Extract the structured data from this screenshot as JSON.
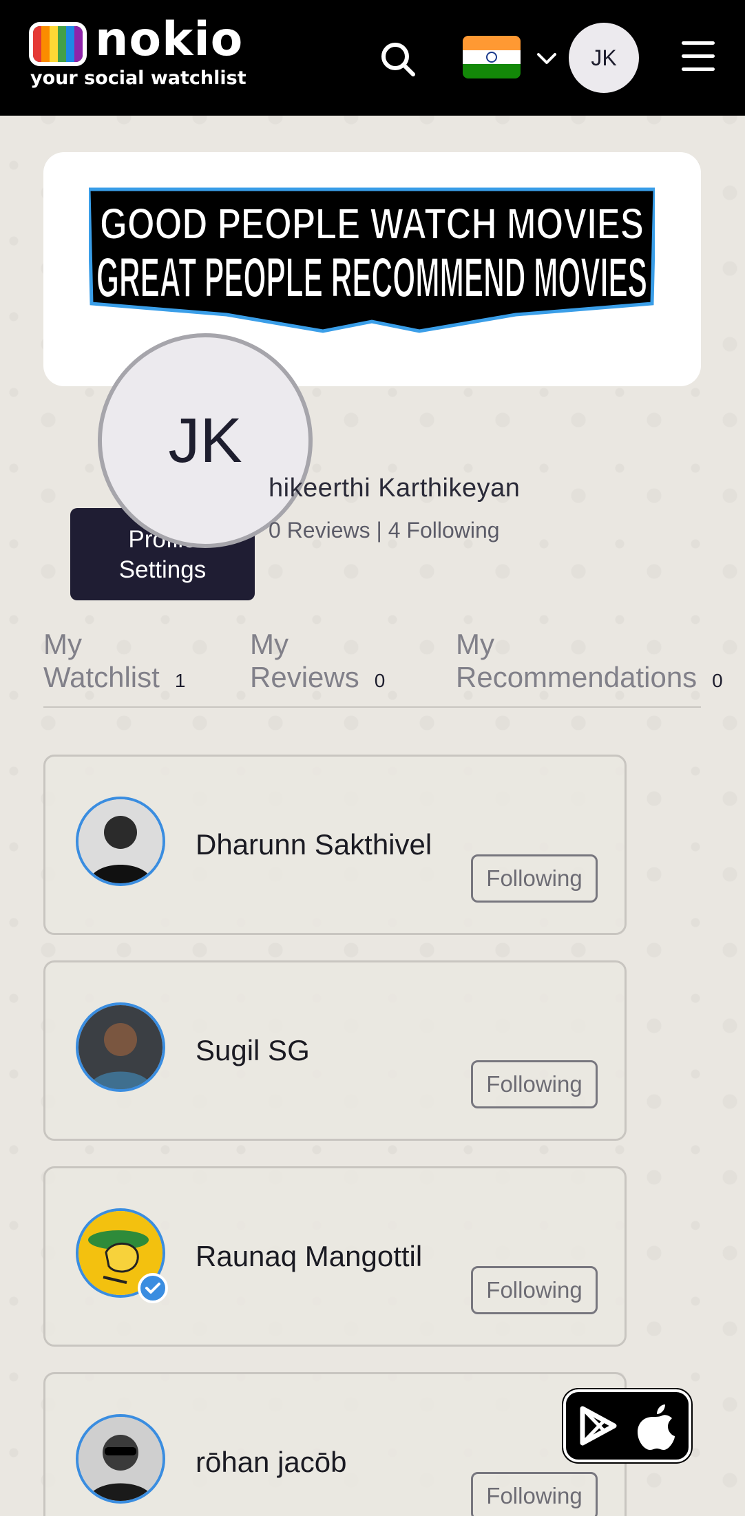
{
  "header": {
    "logo_name": "nokio",
    "logo_tagline": "your social watchlist",
    "logo_stripes": [
      "#e53935",
      "#fb8c00",
      "#fdd835",
      "#43a047",
      "#1e88e5",
      "#8e24aa"
    ],
    "search_icon": "search-icon",
    "country_flag": "india-flag-icon",
    "flag_colors": [
      "#ff9933",
      "#ffffff",
      "#138808"
    ],
    "menu_icon": "hamburger-menu-icon",
    "user_initials": "JK"
  },
  "banner": {
    "line1": "GOOD PEOPLE WATCH MOVIES",
    "line2": "GREAT PEOPLE RECOMMEND MOVIES"
  },
  "profile": {
    "initials": "JK",
    "name_visible": "hikeerthi Karthikeyan",
    "stats": "0 Reviews | 4 Following",
    "settings_line1": "Profile",
    "settings_line2": "Settings"
  },
  "tabs": [
    {
      "line1": "My",
      "line2": "Watchlist",
      "count": "1"
    },
    {
      "line1": "My",
      "line2": "Reviews",
      "count": "0"
    },
    {
      "line1": "My",
      "line2": "Recommendations",
      "count": "0"
    }
  ],
  "following": [
    {
      "name": "Dharunn Sakthivel",
      "button": "Following",
      "avatar": "user-photo-avatar"
    },
    {
      "name": "Sugil SG",
      "button": "Following",
      "avatar": "user-photo-avatar"
    },
    {
      "name": "Raunaq Mangottil",
      "button": "Following",
      "avatar": "cartoon-avatar",
      "verified": true
    },
    {
      "name": "rōhan jacōb",
      "button": "Following",
      "avatar": "user-photo-avatar"
    }
  ],
  "store_widget": {
    "icons": [
      "google-play-icon",
      "apple-icon"
    ]
  },
  "colors": {
    "accent_blue": "#3a8de0",
    "dark_navy": "#1f1d33",
    "page_bg": "#eae7e1"
  }
}
